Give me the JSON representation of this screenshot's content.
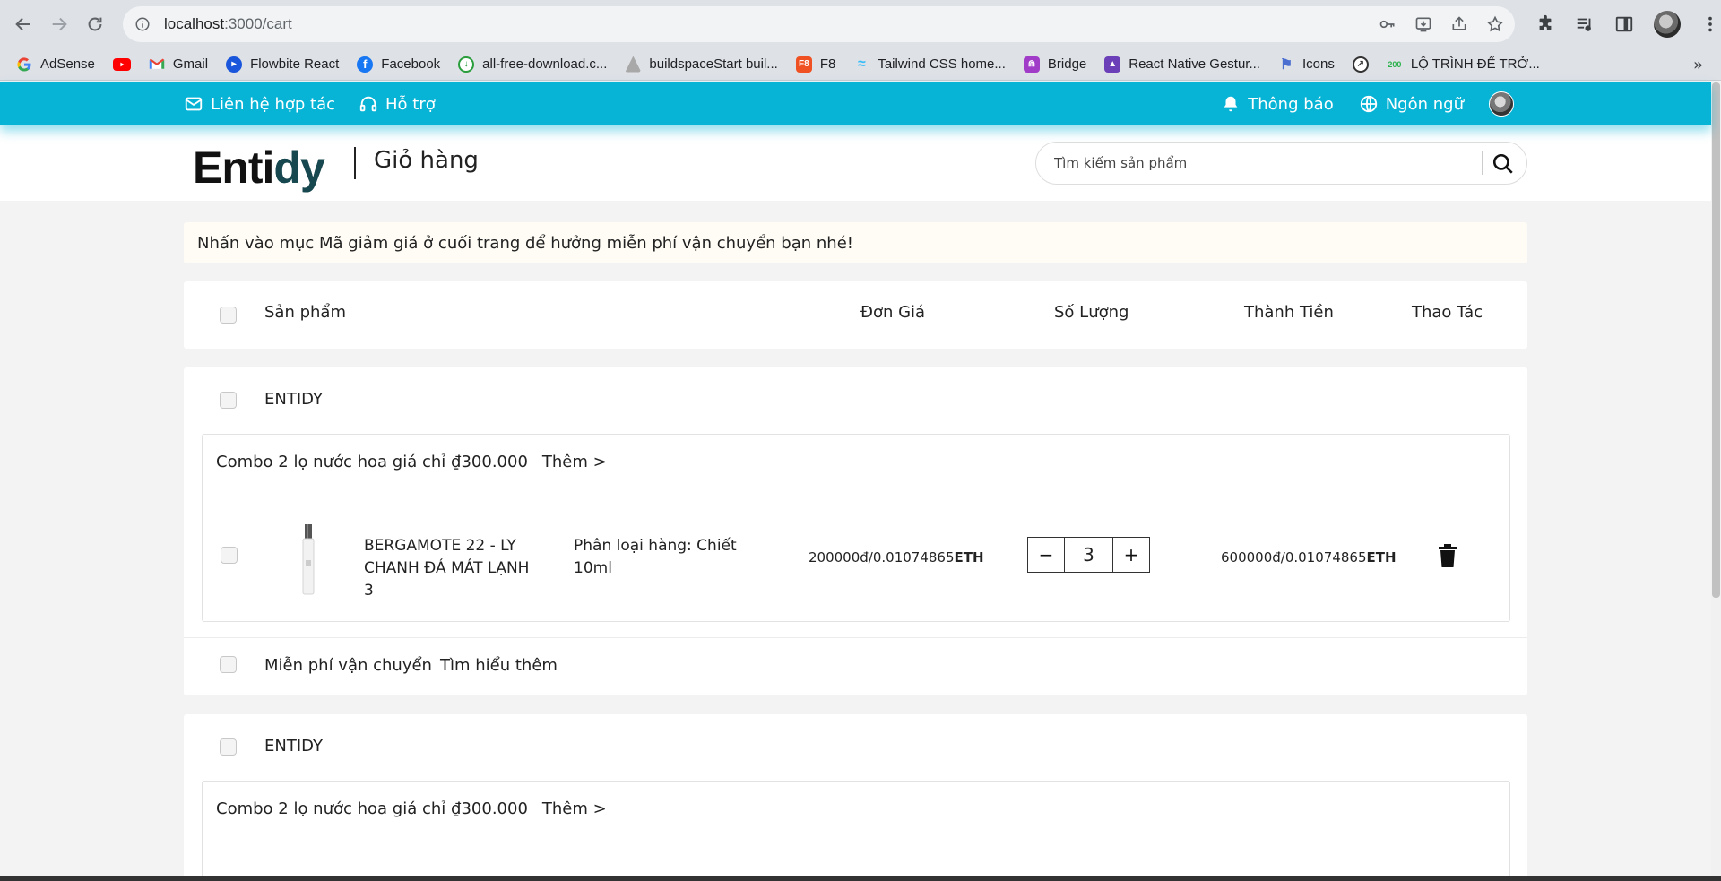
{
  "browser": {
    "url_host": "localhost",
    "url_path": ":3000/cart",
    "bookmarks": [
      {
        "label": "AdSense",
        "icon": "google-icon"
      },
      {
        "label": "",
        "icon": "youtube-icon"
      },
      {
        "label": "Gmail",
        "icon": "gmail-icon"
      },
      {
        "label": "Flowbite React",
        "icon": "flowbite-icon"
      },
      {
        "label": "Facebook",
        "icon": "facebook-icon"
      },
      {
        "label": "all-free-download.c...",
        "icon": "download-icon"
      },
      {
        "label": "buildspaceStart buil...",
        "icon": "buildspace-icon"
      },
      {
        "label": "F8",
        "icon": "f8-icon"
      },
      {
        "label": "Tailwind CSS home...",
        "icon": "tailwind-icon"
      },
      {
        "label": "Bridge",
        "icon": "bridge-icon"
      },
      {
        "label": "React Native Gestur...",
        "icon": "rocket-icon"
      },
      {
        "label": "Icons",
        "icon": "flag-icon"
      },
      {
        "label": "",
        "icon": "compass-icon"
      },
      {
        "label": "LỘ TRÌNH ĐỂ TRỞ...",
        "icon": "200lab-icon"
      }
    ],
    "bookmark_icon_text": {
      "f8": "F8",
      "lab": "200"
    }
  },
  "topbar": {
    "contact": "Liên hệ hợp tác",
    "support": "Hỗ trợ",
    "notifications": "Thông báo",
    "language": "Ngôn ngữ"
  },
  "header": {
    "logo_part1": "Enti",
    "logo_part2": "dy",
    "page_name": "Giỏ hàng",
    "search_placeholder": "Tìm kiếm sản phẩm"
  },
  "notice": "Nhấn vào mục Mã giảm giá ở cuối trang để hưởng miễn phí vận chuyển bạn nhé!",
  "table_header": {
    "product": "Sản phẩm",
    "unit_price": "Đơn Giá",
    "quantity": "Số Lượng",
    "total": "Thành Tiền",
    "actions": "Thao Tác"
  },
  "shops": [
    {
      "name": "ENTIDY",
      "combo": "Combo 2 lọ nước hoa giá chỉ ₫300.000",
      "combo_more": "Thêm >",
      "item": {
        "name": "BERGAMOTE 22 - LY CHANH ĐÁ MÁT LẠNH 3",
        "variant": "Phân loại hàng: Chiết 10ml",
        "price": "200000đ/0.01074865",
        "price_unit": "ETH",
        "quantity": "3",
        "total": "600000đ/0.01074865",
        "total_unit": "ETH"
      },
      "shipping": "Miễn phí vận chuyển",
      "shipping_more": "Tìm hiểu thêm"
    },
    {
      "name": "ENTIDY",
      "combo": "Combo 2 lọ nước hoa giá chỉ ₫300.000",
      "combo_more": "Thêm >"
    }
  ],
  "qty_minus": "−",
  "qty_plus": "+",
  "colors": {
    "accent": "#07b4d6",
    "notice_bg": "#fffcf5"
  }
}
